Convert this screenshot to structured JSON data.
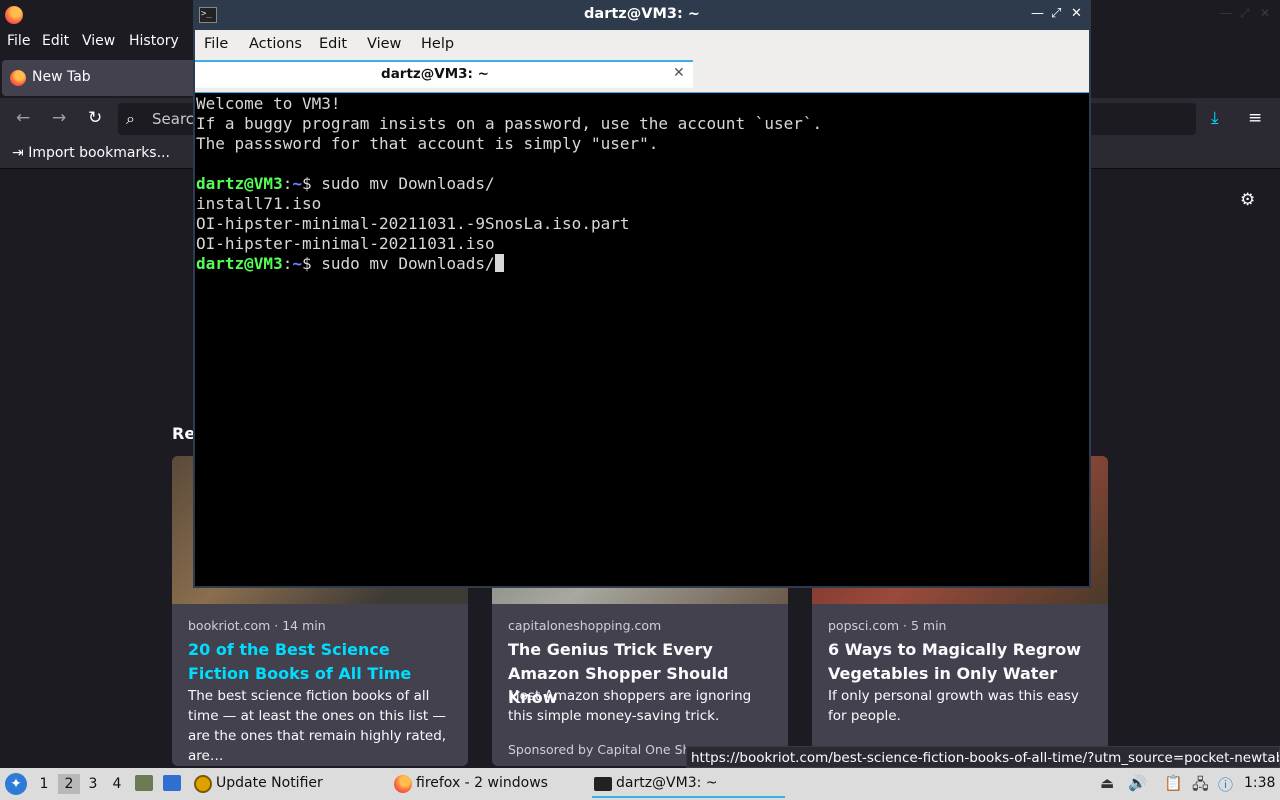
{
  "firefox": {
    "menu": [
      "File",
      "Edit",
      "View",
      "History"
    ],
    "tab_label": "New Tab",
    "url_placeholder": "Searc",
    "bookmark_label": "Import bookmarks...",
    "recent_heading": "Re",
    "cards": [
      {
        "source": "bookriot.com · 14 min",
        "title": "20 of the Best Science Fiction Books of All Time",
        "description": "The best science fiction books of all time — at least the ones on this list — are the ones that remain highly rated, are…",
        "sponsored": ""
      },
      {
        "source": "capitaloneshopping.com",
        "title": "The Genius Trick Every Amazon Shopper Should Know",
        "description": "Most Amazon shoppers are ignoring this simple money-saving trick.",
        "sponsored": "Sponsored by Capital One Sho"
      },
      {
        "source": "popsci.com · 5 min",
        "title": "6 Ways to Magically Regrow Vegetables in Only Water",
        "description": "If only personal growth was this easy for people.",
        "sponsored": ""
      }
    ],
    "status_url": "https://bookriot.com/best-science-fiction-books-of-all-time/?utm_source=pocket-newtab"
  },
  "terminal": {
    "window_title": "dartz@VM3: ~",
    "menu": [
      "File",
      "Actions",
      "Edit",
      "View",
      "Help"
    ],
    "tab_label": "dartz@VM3: ~",
    "output": [
      "Welcome to VM3!",
      "If a buggy program insists on a password, use the account `user`.",
      "The passsword for that account is simply \"user\".",
      "",
      "install71.iso",
      "OI-hipster-minimal-20211031.-9SnosLa.iso.part",
      "OI-hipster-minimal-20211031.iso"
    ],
    "prompt_user": "dartz@VM3",
    "prompt_sep": ":",
    "prompt_path": "~",
    "prompt_dollar": "$ ",
    "commands": [
      "sudo mv Downloads/",
      "sudo mv Downloads/"
    ]
  },
  "taskbar": {
    "workspaces": [
      "1",
      "2",
      "3",
      "4"
    ],
    "tasks": [
      "Update Notifier",
      "firefox - 2 windows",
      "dartz@VM3: ~"
    ],
    "clock": "1:38"
  },
  "colors": {
    "terminal_titlebar": "#2e3b4d",
    "accent": "#3daee9",
    "prompt_user": "#54ff54",
    "prompt_path": "#5c8cff",
    "link": "#00ddff"
  }
}
